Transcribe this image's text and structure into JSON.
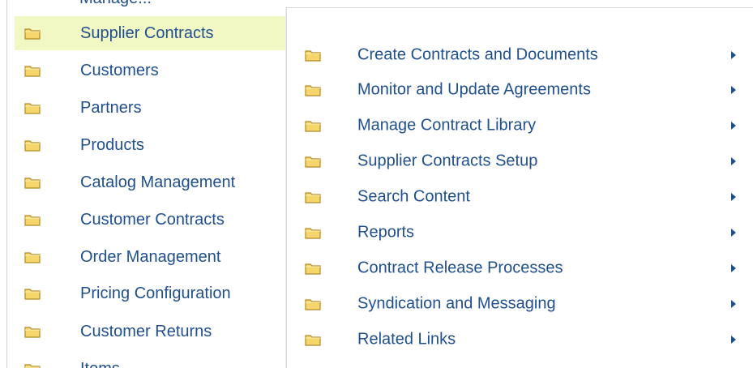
{
  "left_menu": {
    "cut_top_label": "Manage...",
    "items": [
      {
        "label": "Supplier Contracts",
        "selected": true
      },
      {
        "label": "Customers",
        "selected": false
      },
      {
        "label": "Partners",
        "selected": false
      },
      {
        "label": "Products",
        "selected": false
      },
      {
        "label": "Catalog Management",
        "selected": false
      },
      {
        "label": "Customer Contracts",
        "selected": false
      },
      {
        "label": "Order Management",
        "selected": false
      },
      {
        "label": "Pricing Configuration",
        "selected": false
      },
      {
        "label": "Customer Returns",
        "selected": false
      },
      {
        "label": "Items",
        "selected": false
      }
    ]
  },
  "flyout": {
    "items": [
      {
        "label": "Create Contracts and Documents"
      },
      {
        "label": "Monitor and Update Agreements"
      },
      {
        "label": "Manage Contract Library"
      },
      {
        "label": "Supplier Contracts Setup"
      },
      {
        "label": "Search Content"
      },
      {
        "label": "Reports"
      },
      {
        "label": "Contract Release Processes"
      },
      {
        "label": "Syndication and Messaging"
      },
      {
        "label": "Related Links"
      }
    ]
  },
  "colors": {
    "link": "#1f4f8f",
    "selected_bg": "#f2f8c4",
    "folder_fill": "#f6d56a",
    "folder_edge": "#b08a24"
  },
  "icons": {
    "folder": "folder-icon",
    "submenu_arrow": "chevron-right-icon"
  }
}
